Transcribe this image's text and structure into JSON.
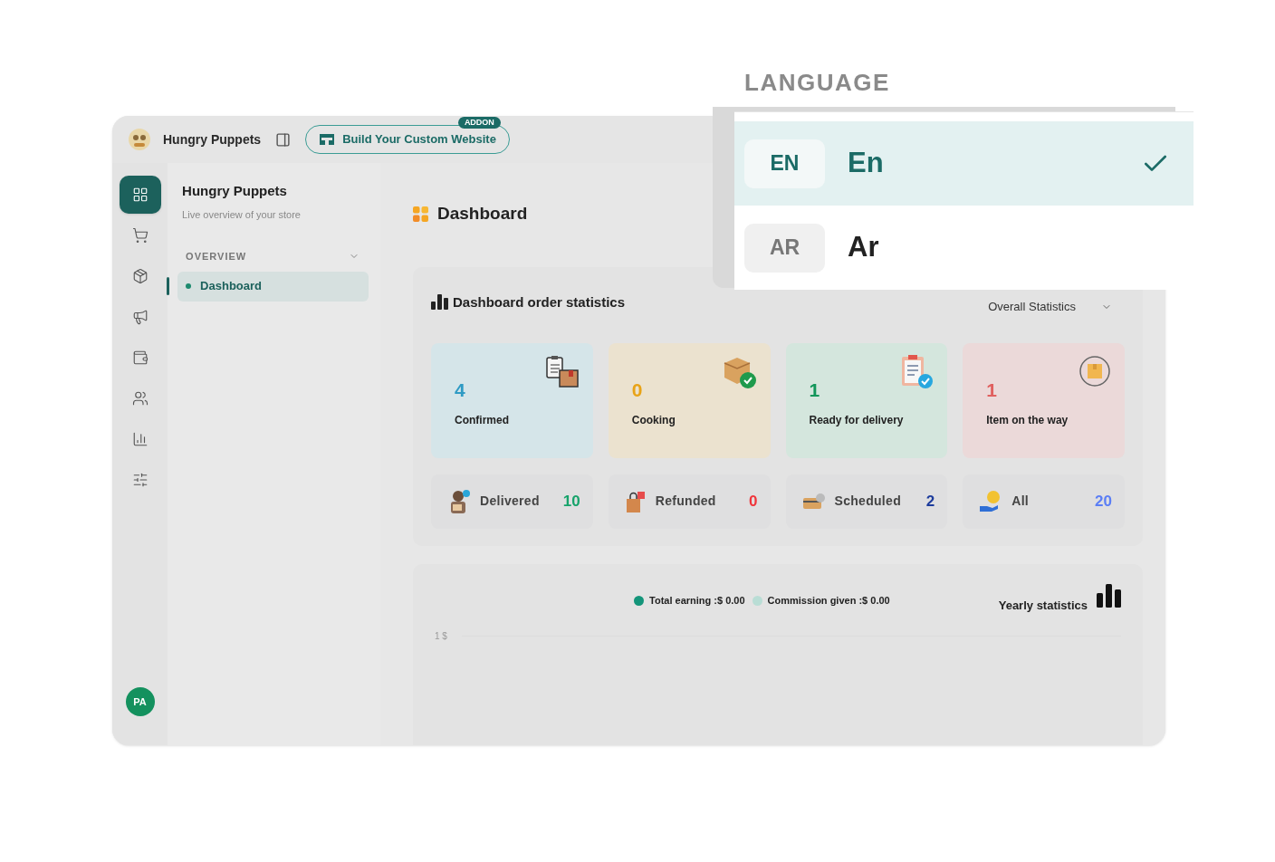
{
  "header": {
    "store_name": "Hungry Puppets",
    "website_button": "Build Your Custom Website",
    "badge": "ADDON"
  },
  "rail": [
    {
      "kind": "grid",
      "selected": true
    },
    {
      "kind": "cart",
      "selected": false
    },
    {
      "kind": "package",
      "selected": false
    },
    {
      "kind": "megaphone",
      "selected": false
    },
    {
      "kind": "wallet",
      "selected": false
    },
    {
      "kind": "users",
      "selected": false
    },
    {
      "kind": "chart",
      "selected": false
    },
    {
      "kind": "sliders",
      "selected": false
    }
  ],
  "avatar": "PA",
  "sidebar": {
    "title": "Hungry Puppets",
    "subtitle": "Live overview of your store",
    "section": "OVERVIEW",
    "items": [
      {
        "label": "Dashboard",
        "selected": true
      }
    ]
  },
  "page_title": "Dashboard",
  "stats": {
    "title": "Dashboard order statistics",
    "filter": "Overall Statistics",
    "cards": [
      {
        "kind": "confirmed",
        "value": "4",
        "label": "Confirmed",
        "color": "#2f9bc4"
      },
      {
        "kind": "cooking",
        "value": "0",
        "label": "Cooking",
        "color": "#e8a317"
      },
      {
        "kind": "ready",
        "value": "1",
        "label": "Ready for delivery",
        "color": "#12965a"
      },
      {
        "kind": "on_the_way",
        "value": "1",
        "label": "Item on the way",
        "color": "#e0605f"
      }
    ],
    "tiles": [
      {
        "kind": "delivered",
        "label": "Delivered",
        "value": "10",
        "color": "#16a36a"
      },
      {
        "kind": "refunded",
        "label": "Refunded",
        "value": "0",
        "color": "#f0353b"
      },
      {
        "kind": "scheduled",
        "label": "Scheduled",
        "value": "2",
        "color": "#1d3c9c"
      },
      {
        "kind": "all",
        "label": "All",
        "value": "20",
        "color": "#5b7ef5"
      }
    ]
  },
  "earnings": {
    "legend": [
      {
        "label": "Total earning :$ 0.00",
        "color": "#14957a"
      },
      {
        "label": "Commission given :$ 0.00",
        "color": "#b9ddd5"
      }
    ],
    "title": "Yearly statistics",
    "axis_label": "1 $"
  },
  "language": {
    "title": "LANGUAGE",
    "options": [
      {
        "code": "EN",
        "label": "En",
        "selected": true
      },
      {
        "code": "AR",
        "label": "Ar",
        "selected": false
      }
    ]
  }
}
